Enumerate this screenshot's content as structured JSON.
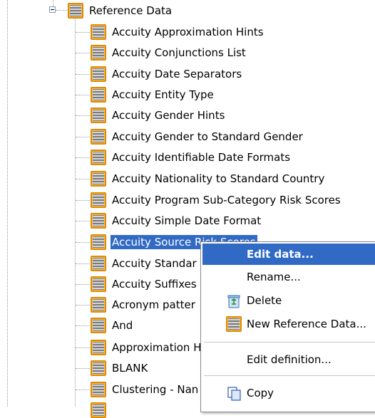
{
  "tree": {
    "parent": {
      "label": "Reference Data",
      "expander": "collapse-minus"
    },
    "items": [
      {
        "label": "Accuity Approximation Hints",
        "selected": false
      },
      {
        "label": "Accuity Conjunctions List",
        "selected": false
      },
      {
        "label": "Accuity Date Separators",
        "selected": false
      },
      {
        "label": "Accuity Entity Type",
        "selected": false
      },
      {
        "label": "Accuity Gender Hints",
        "selected": false
      },
      {
        "label": "Accuity Gender to Standard Gender",
        "selected": false
      },
      {
        "label": "Accuity Identifiable Date Formats",
        "selected": false
      },
      {
        "label": "Accuity Nationality to Standard Country",
        "selected": false
      },
      {
        "label": "Accuity Program Sub-Category Risk Scores",
        "selected": false
      },
      {
        "label": "Accuity Simple Date Format",
        "selected": false
      },
      {
        "label": "Accuity Source Risk Scores",
        "selected": true
      },
      {
        "label": "Accuity Standar",
        "selected": false
      },
      {
        "label": "Accuity Suffixes",
        "selected": false
      },
      {
        "label": "Acronym patter",
        "selected": false
      },
      {
        "label": "And",
        "selected": false
      },
      {
        "label": "Approximation H",
        "selected": false
      },
      {
        "label": "BLANK",
        "selected": false
      },
      {
        "label": "Clustering - Nan",
        "selected": false
      }
    ]
  },
  "context_menu": {
    "items": [
      {
        "label": "Edit data...",
        "icon": "none",
        "highlighted": true
      },
      {
        "label": "Rename...",
        "icon": "none",
        "highlighted": false
      },
      {
        "label": "Delete",
        "icon": "recycle-bin-icon",
        "highlighted": false
      },
      {
        "label": "New Reference Data...",
        "icon": "reference-data-icon",
        "highlighted": false
      },
      {
        "label": "Edit definition...",
        "icon": "none",
        "highlighted": false
      },
      {
        "label": "Copy",
        "icon": "copy-icon",
        "highlighted": false
      }
    ]
  },
  "colors": {
    "selection": "#316ac5",
    "icon_border": "#e08a00",
    "tree_line": "#9a9a9a"
  }
}
